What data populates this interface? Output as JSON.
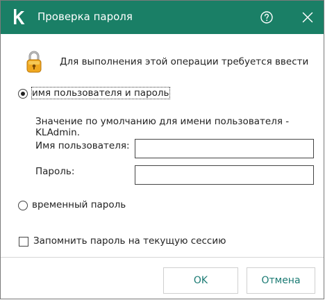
{
  "window": {
    "title": "Проверка пароля",
    "titlebar_color": "#1a7f66",
    "app_icon": "kaspersky-k-icon",
    "help_icon": "help-circle-icon",
    "close_icon": "close-icon"
  },
  "prompt": {
    "icon": "lock-icon",
    "text": "Для выполнения этой операции требуется ввести"
  },
  "auth_options": {
    "user_password": {
      "label": "имя пользователя и пароль",
      "selected": true
    },
    "temp_password": {
      "label": "временный пароль",
      "selected": false
    }
  },
  "credentials": {
    "hint": "Значение по умолчанию для имени пользователя - KLAdmin.",
    "username_label": "Имя пользователя:",
    "username_value": "",
    "password_label": "Пароль:",
    "password_value": ""
  },
  "remember": {
    "label": "Запомнить пароль на текущую сессию",
    "checked": false
  },
  "footer": {
    "ok_label": "OK",
    "cancel_label": "Отмена",
    "button_text_color": "#1a7a73"
  }
}
